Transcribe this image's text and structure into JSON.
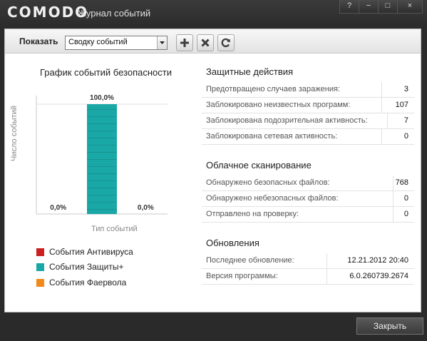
{
  "window": {
    "brand": "COMODO",
    "title": "Журнал событий",
    "controls": [
      "?",
      "−",
      "□",
      "×"
    ]
  },
  "toolbar": {
    "show_label": "Показать",
    "select_value": "Сводку событий",
    "buttons": [
      "add-icon",
      "delete-icon",
      "refresh-icon"
    ]
  },
  "chart": {
    "title": "График событий безопасности",
    "ylabel": "Число событий",
    "xlabel": "Тип событий"
  },
  "chart_data": {
    "type": "bar",
    "categories": [
      "События Антивируса",
      "События Защиты+",
      "События Фаервола"
    ],
    "values": [
      0,
      100,
      0
    ],
    "value_labels": [
      "0,0%",
      "100,0%",
      "0,0%"
    ],
    "colors": [
      "#cc1f1f",
      "#1aa8a6",
      "#f08a18"
    ],
    "ylim": [
      0,
      100
    ],
    "xlabel": "Тип событий",
    "ylabel": "Число событий",
    "title": "График событий безопасности",
    "grid": true
  },
  "legend": [
    {
      "label": "События Антивируса",
      "color": "#cc1f1f"
    },
    {
      "label": "События Защиты+",
      "color": "#1aa8a6"
    },
    {
      "label": "События Фаервола",
      "color": "#f08a18"
    }
  ],
  "sections": {
    "protection": {
      "title": "Защитные действия",
      "rows": [
        {
          "label": "Предотвращено случаев заражения:",
          "value": "3"
        },
        {
          "label": "Заблокировано неизвестных программ:",
          "value": "107"
        },
        {
          "label": "Заблокирована подозрительная активность:",
          "value": "7"
        },
        {
          "label": "Заблокирована сетевая активность:",
          "value": "0"
        }
      ]
    },
    "cloud": {
      "title": "Облачное сканирование",
      "rows": [
        {
          "label": "Обнаружено безопасных файлов:",
          "value": "768"
        },
        {
          "label": "Обнаружено небезопасных файлов:",
          "value": "0"
        },
        {
          "label": "Отправлено на проверку:",
          "value": "0"
        }
      ]
    },
    "updates": {
      "title": "Обновления",
      "rows": [
        {
          "label": "Последнее обновление:",
          "value": "12.21.2012 20:40"
        },
        {
          "label": "Версия программы:",
          "value": "6.0.260739.2674"
        }
      ]
    }
  },
  "footer": {
    "close_label": "Закрыть"
  }
}
